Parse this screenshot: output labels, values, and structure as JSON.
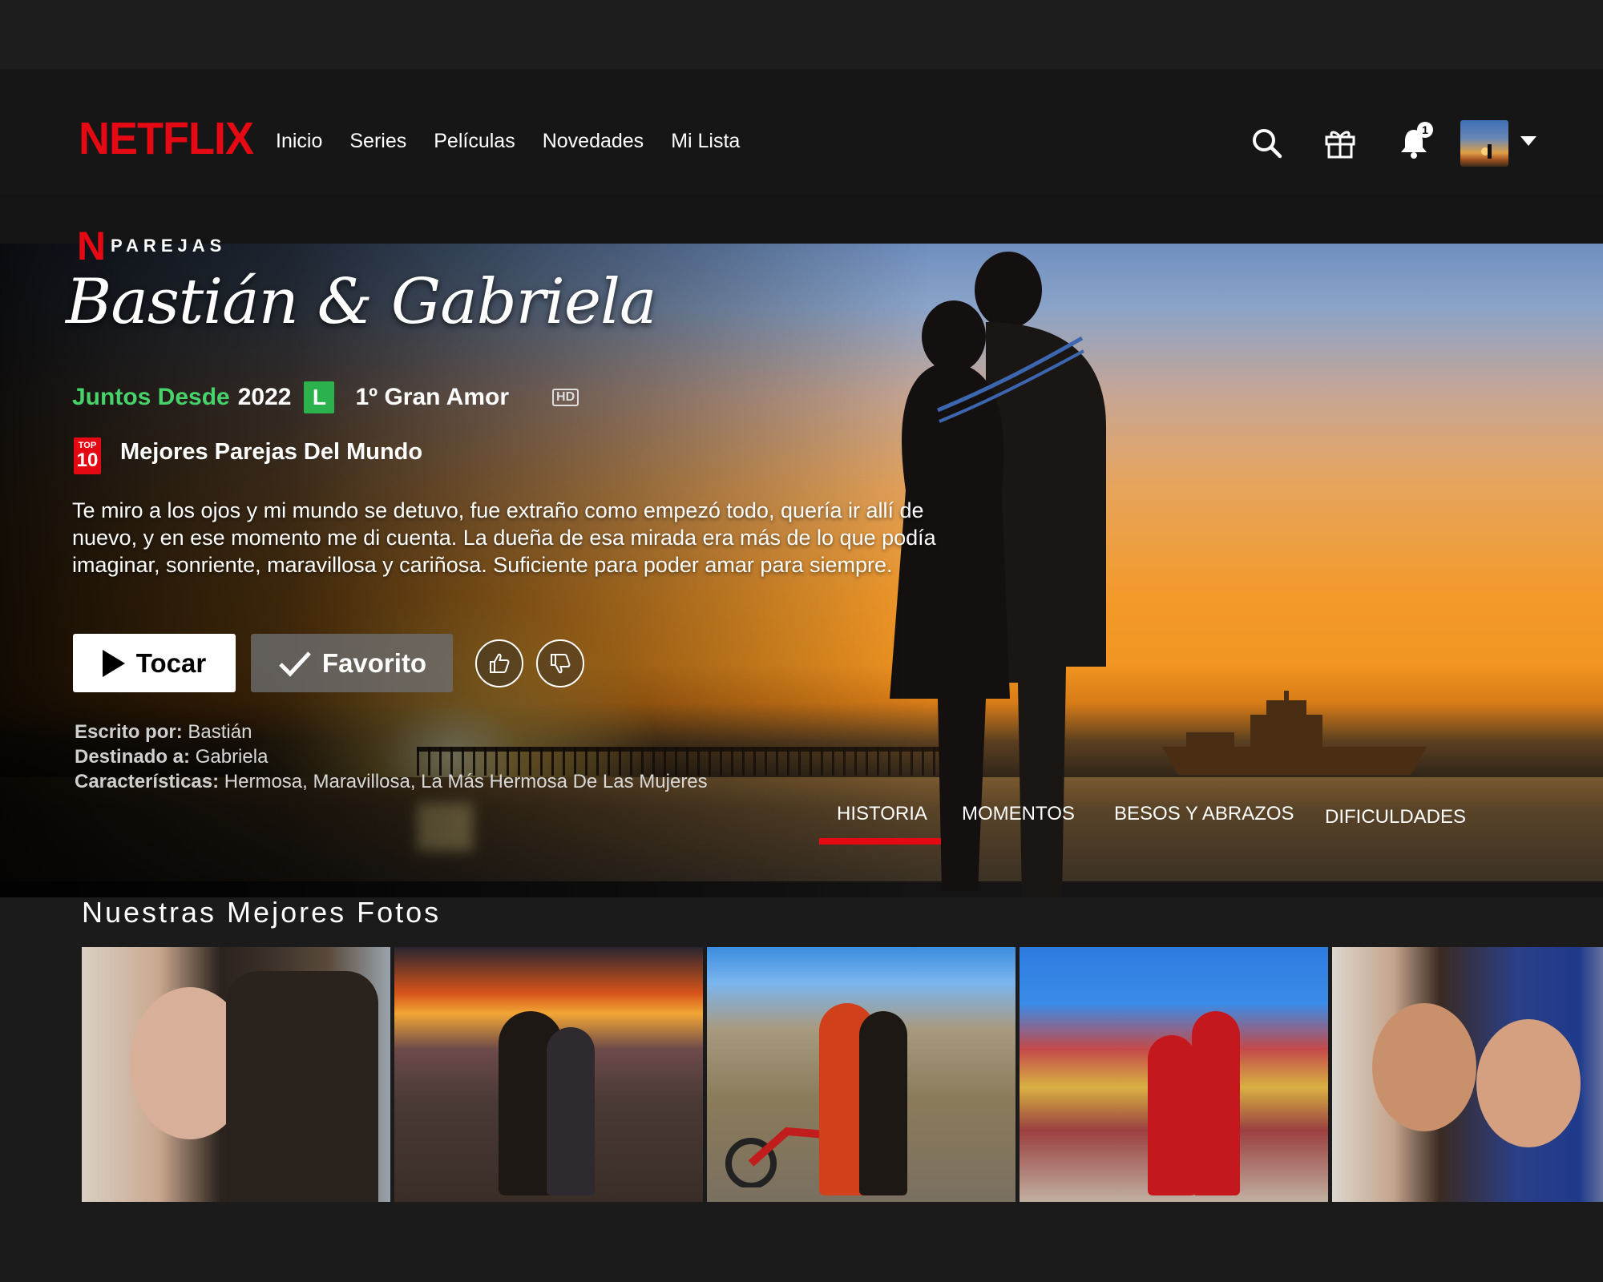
{
  "nav": {
    "logo": "NETFLIX",
    "links": [
      "Inicio",
      "Series",
      "Películas",
      "Novedades",
      "Mi Lista"
    ],
    "icons": [
      "search-icon",
      "gift-icon",
      "bell-icon",
      "avatar",
      "caret-down-icon"
    ],
    "notification_count": "1"
  },
  "hero": {
    "badge_letter": "N",
    "badge_label": "PAREJAS",
    "title": "Bastián & Gabriela",
    "meta": {
      "together_label": "Juntos Desde",
      "year": "2022",
      "rating": "L",
      "subtitle": "1º Gran Amor",
      "quality": "HD"
    },
    "rank": {
      "top_label": "TOP",
      "top_number": "10",
      "text": "Mejores Parejas Del Mundo"
    },
    "description": "Te miro a los ojos y mi mundo se detuvo, fue extraño como empezó todo, quería ir allí de nuevo, y en ese momento me di cuenta. La dueña de esa mirada era más de lo que podía imaginar, sonriente, maravillosa y cariñosa. Suficiente para poder amar para siempre.",
    "buttons": {
      "play": "Tocar",
      "favorite": "Favorito"
    },
    "credits": {
      "written_label": "Escrito por:",
      "written_value": "Bastián",
      "destined_label": "Destinado a:",
      "destined_value": "Gabriela",
      "traits_label": "Características:",
      "traits_value": "Hermosa, Maravillosa, La Más Hermosa De Las Mujeres"
    },
    "tabs": [
      "HISTORIA",
      "MOMENTOS",
      "BESOS Y ABRAZOS",
      "DIFICULDADES"
    ],
    "active_tab": "HISTORIA"
  },
  "photos": {
    "title": "Nuestras Mejores Fotos",
    "count": 5
  },
  "colors": {
    "brand_red": "#e50914",
    "rating_green": "#2bb24c",
    "highlight_green": "#46d369",
    "background": "#1b1b1b"
  }
}
